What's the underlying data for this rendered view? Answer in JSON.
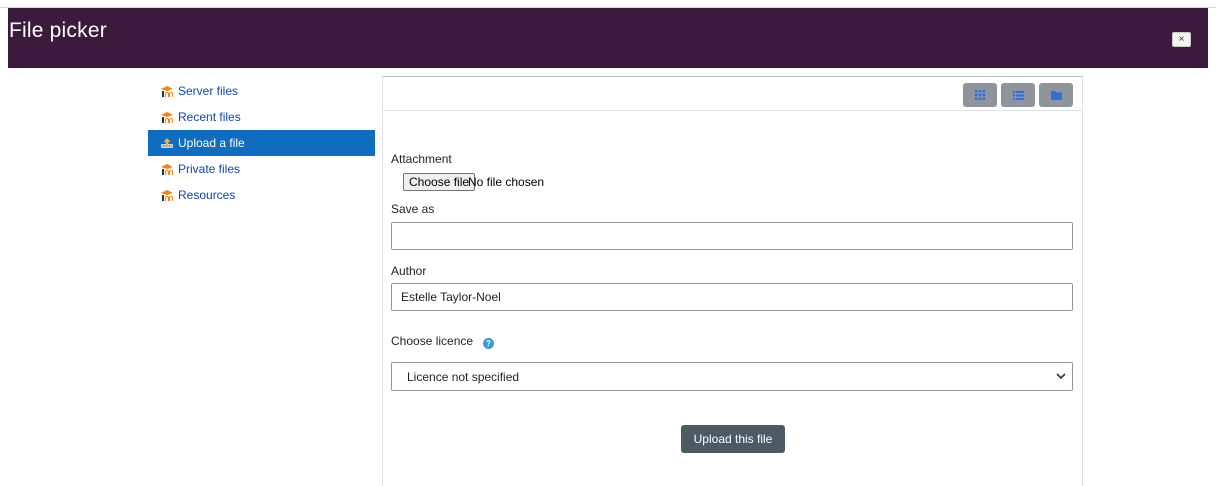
{
  "header": {
    "title": "File picker",
    "close_label": "×"
  },
  "sidebar": {
    "items": [
      {
        "label": "Server files",
        "icon": "moodle-icon"
      },
      {
        "label": "Recent files",
        "icon": "moodle-icon"
      },
      {
        "label": "Upload a file",
        "icon": "upload-icon",
        "active": true
      },
      {
        "label": "Private files",
        "icon": "moodle-icon"
      },
      {
        "label": "Resources",
        "icon": "moodle-icon"
      }
    ]
  },
  "toolbar": {
    "views": [
      {
        "icon": "grid-icon"
      },
      {
        "icon": "list-icon"
      },
      {
        "icon": "folder-icon"
      }
    ]
  },
  "form": {
    "attachment_label": "Attachment",
    "choose_file_label": "Choose file",
    "no_file_text": "No file chosen",
    "save_as_label": "Save as",
    "save_as_value": "",
    "author_label": "Author",
    "author_value": "Estelle Taylor-Noel",
    "licence_label": "Choose licence",
    "licence_help": "?",
    "licence_selected": "Licence not specified",
    "submit_label": "Upload this file"
  },
  "colors": {
    "header_bg": "#3c1a3e",
    "active_item_bg": "#0f6cbf",
    "link": "#0f47ad",
    "view_button": "#8f959e",
    "upload_button": "#4b5b66",
    "help_icon": "#3a9bd0"
  }
}
